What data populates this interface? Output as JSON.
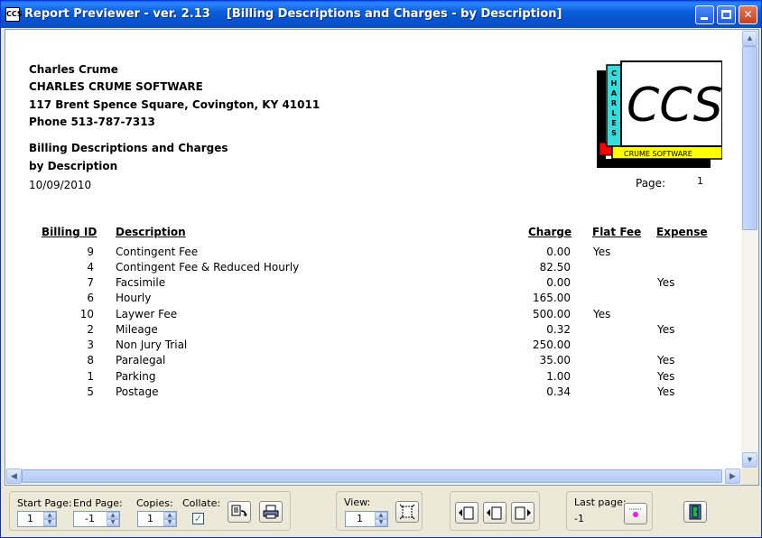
{
  "window": {
    "title": "Report Previewer - ver. 2.13    [Billing Descriptions and Charges - by Description]",
    "icon_text": "CCS"
  },
  "report": {
    "company": {
      "name": "Charles Crume",
      "business": "CHARLES CRUME SOFTWARE",
      "address": "117 Brent Spence Square, Covington, KY 41011",
      "phone": "Phone 513-787-7313"
    },
    "title_line1": "Billing Descriptions and Charges",
    "title_line2": "by Description",
    "date": "10/09/2010",
    "page_label": "Page:",
    "page_number": "1",
    "logo": {
      "main_text": "CCS",
      "vertical_text": "CHARLES",
      "banner_text": "CRUME SOFTWARE"
    },
    "columns": {
      "billing_id": "Billing ID",
      "description": "Description",
      "charge": "Charge",
      "flat_fee": "Flat Fee",
      "expense": "Expense"
    },
    "rows": [
      {
        "id": "9",
        "description": "Contingent Fee",
        "charge": "0.00",
        "flat_fee": "Yes",
        "expense": ""
      },
      {
        "id": "4",
        "description": "Contingent Fee & Reduced Hourly",
        "charge": "82.50",
        "flat_fee": "",
        "expense": ""
      },
      {
        "id": "7",
        "description": "Facsimile",
        "charge": "0.00",
        "flat_fee": "",
        "expense": "Yes"
      },
      {
        "id": "6",
        "description": "Hourly",
        "charge": "165.00",
        "flat_fee": "",
        "expense": ""
      },
      {
        "id": "10",
        "description": "Laywer Fee",
        "charge": "500.00",
        "flat_fee": "Yes",
        "expense": ""
      },
      {
        "id": "2",
        "description": "Mileage",
        "charge": "0.32",
        "flat_fee": "",
        "expense": "Yes"
      },
      {
        "id": "3",
        "description": "Non Jury Trial",
        "charge": "250.00",
        "flat_fee": "",
        "expense": ""
      },
      {
        "id": "8",
        "description": "Paralegal",
        "charge": "35.00",
        "flat_fee": "",
        "expense": "Yes"
      },
      {
        "id": "1",
        "description": "Parking",
        "charge": "1.00",
        "flat_fee": "",
        "expense": "Yes"
      },
      {
        "id": "5",
        "description": "Postage",
        "charge": "0.34",
        "flat_fee": "",
        "expense": "Yes"
      }
    ]
  },
  "toolbar": {
    "start_page_label": "Start Page:",
    "start_page_value": "1",
    "end_page_label": "End Page:",
    "end_page_value": "-1",
    "copies_label": "Copies:",
    "copies_value": "1",
    "collate_label": "Collate:",
    "collate_checked": true,
    "view_label": "View:",
    "view_value": "1",
    "last_page_label": "Last page:",
    "last_page_value": "-1"
  },
  "colors": {
    "titlebar": "#0a5fd9",
    "logo_cyan": "#33dddd",
    "logo_yellow": "#ffff00",
    "logo_red": "#ff0000",
    "check_green": "#21a121"
  },
  "icons": {
    "print_setup": "printer-setup-icon",
    "print": "printer-icon",
    "zoom": "zoom-icon",
    "first_page": "first-page-icon",
    "prev_page": "previous-page-icon",
    "next_page": "next-page-icon",
    "last_page": "last-page-icon",
    "exit": "exit-door-icon"
  }
}
